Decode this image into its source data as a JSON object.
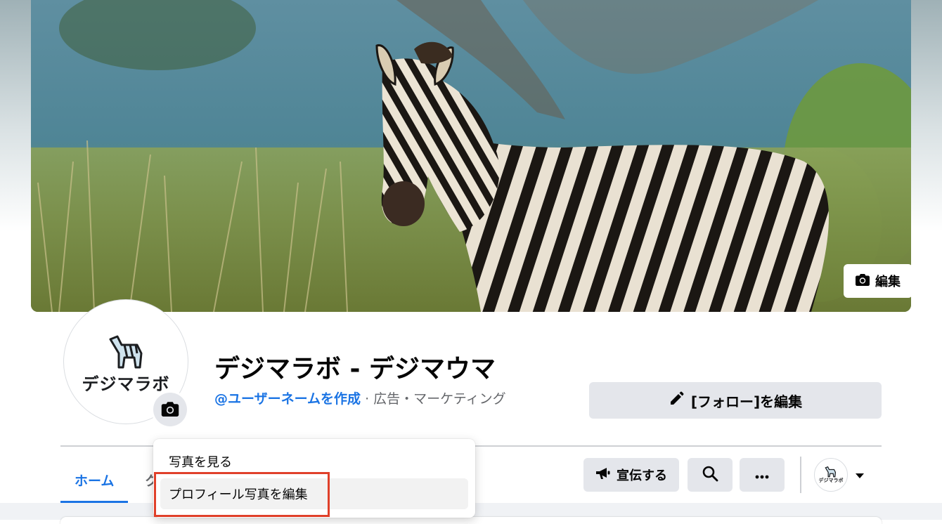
{
  "cover": {
    "edit_label": "編集"
  },
  "profile": {
    "avatar_text": "デジマラボ",
    "name": "デジマラボ - デジマウマ",
    "username_link": "@ユーザーネームを作成",
    "category": " · 広告・マーケティング"
  },
  "actions": {
    "edit_follow": "[フォロー]を編集",
    "promote": "宣伝する"
  },
  "tabs": [
    {
      "label": "ホーム",
      "active": true
    },
    {
      "label": "ク",
      "active": false
    }
  ],
  "menu": {
    "items": [
      {
        "label": "写真を見る"
      },
      {
        "label": "プロフィール写真を編集"
      }
    ]
  },
  "icons": [
    "camera-icon",
    "pencil-icon",
    "megaphone-icon",
    "search-icon",
    "more-icon",
    "caret-down-icon",
    "zebra-logo-icon"
  ],
  "colors": {
    "accent": "#1b74e4",
    "highlight": "#e0402a",
    "button_bg": "#e4e6eb"
  }
}
